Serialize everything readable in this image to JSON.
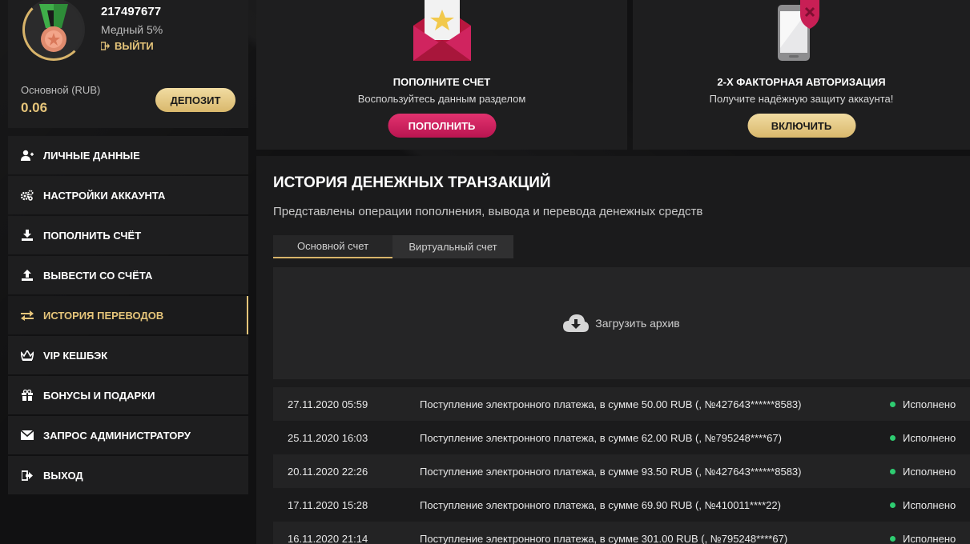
{
  "profile": {
    "user_id": "217497677",
    "level": "Медный 5%",
    "logout_label": "ВЫЙТИ",
    "balance_label": "Основной (RUB)",
    "balance_value": "0.06",
    "deposit_label": "ДЕПОЗИТ"
  },
  "menu": {
    "items": [
      {
        "label": "ЛИЧНЫЕ ДАННЫЕ",
        "icon": "user-add-icon"
      },
      {
        "label": "НАСТРОЙКИ АККАУНТА",
        "icon": "gears-icon"
      },
      {
        "label": "ПОПОЛНИТЬ СЧЁТ",
        "icon": "download-icon"
      },
      {
        "label": "ВЫВЕСТИ СО СЧЁТА",
        "icon": "upload-icon"
      },
      {
        "label": "ИСТОРИЯ ПЕРЕВОДОВ",
        "icon": "transfer-arrows-icon"
      },
      {
        "label": "VIP КЕШБЭК",
        "icon": "crown-icon"
      },
      {
        "label": "БОНУСЫ И ПОДАРКИ",
        "icon": "gift-icon"
      },
      {
        "label": "ЗАПРОС АДМИНИСТРАТОРУ",
        "icon": "envelope-icon"
      },
      {
        "label": "ВЫХОД",
        "icon": "logout-icon"
      }
    ],
    "active_index": 4
  },
  "cards": {
    "topup": {
      "title": "ПОПОЛНИТЕ СЧЕТ",
      "subtitle": "Воспользуйтесь данным разделом",
      "button": "ПОПОЛНИТЬ"
    },
    "twofa": {
      "title": "2-Х ФАКТОРНАЯ АВТОРИЗАЦИЯ",
      "subtitle": "Получите надёжную защиту аккаунта!",
      "button": "ВКЛЮЧИТЬ"
    }
  },
  "history": {
    "title": "ИСТОРИЯ ДЕНЕЖНЫХ ТРАНЗАКЦИЙ",
    "description": "Представлены операции пополнения, вывода и перевода денежных средств",
    "tabs": [
      "Основной счет",
      "Виртуальный счет"
    ],
    "archive_label": "Загрузить архив",
    "transactions": [
      {
        "date": "27.11.2020 05:59",
        "description": "Поступление электронного платежа, в сумме 50.00 RUB (, №427643******8583)",
        "status": "Исполнено"
      },
      {
        "date": "25.11.2020 16:03",
        "description": "Поступление электронного платежа, в сумме 62.00 RUB (, №795248****67)",
        "status": "Исполнено"
      },
      {
        "date": "20.11.2020 22:26",
        "description": "Поступление электронного платежа, в сумме 93.50 RUB (, №427643******8583)",
        "status": "Исполнено"
      },
      {
        "date": "17.11.2020 15:28",
        "description": "Поступление электронного платежа, в сумме 69.90 RUB (, №410011****22)",
        "status": "Исполнено"
      },
      {
        "date": "16.11.2020 21:14",
        "description": "Поступление электронного платежа, в сумме 301.00 RUB (, №795248****67)",
        "status": "Исполнено"
      }
    ]
  },
  "colors": {
    "accent_gold": "#e6c57a",
    "accent_pink": "#d0245f",
    "status_green": "#2ecc71"
  }
}
